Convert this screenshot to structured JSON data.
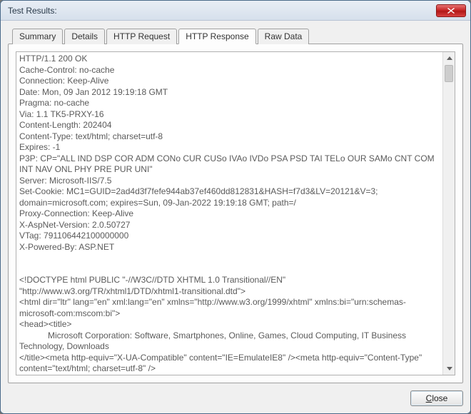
{
  "window": {
    "title": "Test Results:"
  },
  "tabs": [
    {
      "label": "Summary"
    },
    {
      "label": "Details"
    },
    {
      "label": "HTTP Request"
    },
    {
      "label": "HTTP Response"
    },
    {
      "label": "Raw Data"
    }
  ],
  "active_tab_index": 3,
  "response_body": "HTTP/1.1 200 OK\nCache-Control: no-cache\nConnection: Keep-Alive\nDate: Mon, 09 Jan 2012 19:19:18 GMT\nPragma: no-cache\nVia: 1.1 TK5-PRXY-16\nContent-Length: 202404\nContent-Type: text/html; charset=utf-8\nExpires: -1\nP3P: CP=\"ALL IND DSP COR ADM CONo CUR CUSo IVAo IVDo PSA PSD TAI TELo OUR SAMo CNT COM INT NAV ONL PHY PRE PUR UNI\"\nServer: Microsoft-IIS/7.5\nSet-Cookie: MC1=GUID=2ad4d3f7fefe944ab37ef460dd812831&HASH=f7d3&LV=20121&V=3; domain=microsoft.com; expires=Sun, 09-Jan-2022 19:19:18 GMT; path=/\nProxy-Connection: Keep-Alive\nX-AspNet-Version: 2.0.50727\nVTag: 791106442100000000\nX-Powered-By: ASP.NET\n\n\n<!DOCTYPE html PUBLIC \"-//W3C//DTD XHTML 1.0 Transitional//EN\" \"http://www.w3.org/TR/xhtml1/DTD/xhtml1-transitional.dtd\">\n<html dir=\"ltr\" lang=\"en\" xml:lang=\"en\" xmlns=\"http://www.w3.org/1999/xhtml\" xmlns:bi=\"urn:schemas-microsoft-com:mscom:bi\">\n<head><title>\n            Microsoft Corporation: Software, Smartphones, Online, Games, Cloud Computing, IT Business Technology, Downloads\n</title><meta http-equiv=\"X-UA-Compatible\" content=\"IE=EmulateIE8\" /><meta http-equiv=\"Content-Type\" content=\"text/html; charset=utf-8\" />\n<script type=\"text/javascript\">\n var QosInitTime = (new Date()).getTime();\n var QosLoadTime = '';\n var QosPageUri = encodeURI(window.location);",
  "buttons": {
    "close_label": "Close",
    "close_accel": "C"
  }
}
